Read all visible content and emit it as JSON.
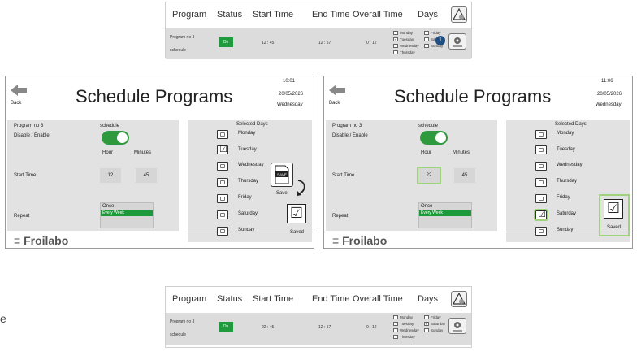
{
  "strip": {
    "headers": [
      "Program",
      "Status",
      "Start Time",
      "End Time",
      "Overall Time",
      "Days"
    ],
    "program_name": "Program no 3",
    "schedule_label": "schedule",
    "status": "On",
    "start_time_top": "12 : 45",
    "start_time_bottom": "22 : 45",
    "end_time": "12 : 57",
    "overall_time": "0 : 12",
    "days_col1": [
      "Monday",
      "Tuesday",
      "Wednesday",
      "Thursday"
    ],
    "days_col2": [
      "Friday",
      "Saturday",
      "Sunday"
    ],
    "step_badge": "1"
  },
  "left": {
    "time": "10:01",
    "date": "20/05/2026",
    "weekday": "Wednesday",
    "start_hour": "12",
    "start_minutes": "45",
    "save_label": "Save",
    "saved_label": "Saved",
    "save_icon_text": "SAVE"
  },
  "right": {
    "time": "11:06",
    "date": "20/05/2026",
    "weekday": "Wednesday",
    "start_hour": "22",
    "start_minutes": "45",
    "saved_label": "Saved"
  },
  "common": {
    "back": "Back",
    "title": "Schedule Programs",
    "program": "Program no 3",
    "schedule": "schedule",
    "disable_enable": "Disable / Enable",
    "hour": "Hour",
    "minutes": "Minutes",
    "start_time": "Start Time",
    "repeat": "Repeat",
    "once": "Once",
    "every_week": "Every Week",
    "selected_days": "Selected Days",
    "days": [
      "Monday",
      "Tuesday",
      "Wednesday",
      "Thursday",
      "Friday",
      "Saturday",
      "Sunday"
    ],
    "logo": "Froilabo"
  },
  "side_letter": "e"
}
